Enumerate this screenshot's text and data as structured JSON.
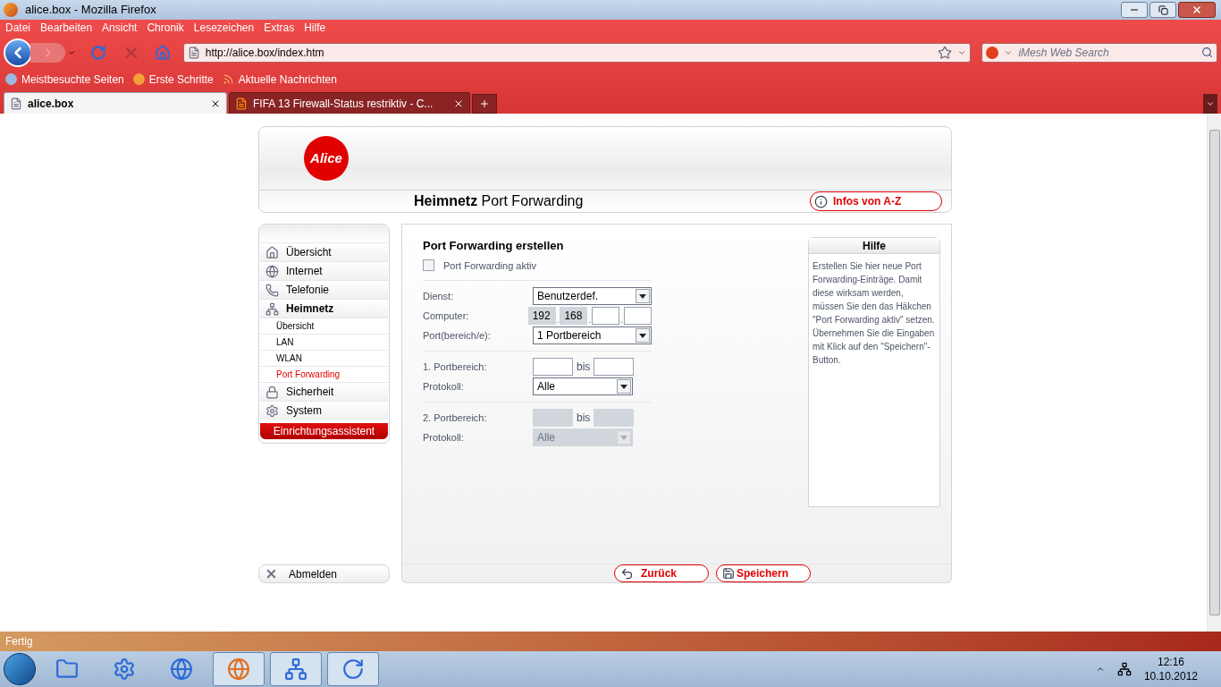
{
  "window": {
    "title": "alice.box - Mozilla Firefox"
  },
  "menu": [
    "Datei",
    "Bearbeiten",
    "Ansicht",
    "Chronik",
    "Lesezeichen",
    "Extras",
    "Hilfe"
  ],
  "navigation": {
    "url": "http://alice.box/index.htm",
    "search_placeholder": "iMesh Web Search"
  },
  "bookmarks": [
    "Meistbesuchte Seiten",
    "Erste Schritte",
    "Aktuelle Nachrichten"
  ],
  "tabs": [
    {
      "label": "alice.box",
      "selected": true
    },
    {
      "label": "FIFA 13 Firewall-Status restriktiv - C...",
      "selected": false
    }
  ],
  "page": {
    "logo": "Alice",
    "heading": "**Heimnetz** Port Forwarding",
    "infos_button": "Infos von A-Z",
    "sidebar": [
      {
        "label": "Übersicht",
        "expanded": false
      },
      {
        "label": "Internet",
        "expanded": false
      },
      {
        "label": "Telefonie",
        "expanded": false
      },
      {
        "label": "Heimnetz",
        "expanded": true,
        "children": [
          {
            "label": "Übersicht",
            "selected": false
          },
          {
            "label": "LAN",
            "selected": false
          },
          {
            "label": "WLAN",
            "selected": false
          },
          {
            "label": "Port Forwarding",
            "selected": true
          }
        ]
      },
      {
        "label": "Sicherheit",
        "expanded": false
      },
      {
        "label": "System",
        "expanded": false
      }
    ],
    "wizard_button": "Einrichtungsassistent",
    "logout_button": "Abmelden",
    "form": {
      "title": "Port Forwarding erstellen",
      "active_checkbox": {
        "label": "Port Forwarding aktiv",
        "checked": false
      },
      "sections": [
        [
          {
            "kind": "select",
            "label": "Dienst:",
            "value": "Benutzerdef.",
            "disabled": false
          },
          {
            "kind": "ip",
            "label": "Computer:",
            "separator": ".",
            "octets": [
              {
                "value": "192",
                "disabled": true
              },
              {
                "value": "168",
                "disabled": true
              },
              {
                "disabled": false
              },
              {
                "disabled": false
              }
            ]
          },
          {
            "kind": "select",
            "label": "Port(bereich/e):",
            "value": "1 Portbereich",
            "disabled": false
          }
        ],
        [
          {
            "kind": "range",
            "label": "1. Portbereich:",
            "connector": "bis",
            "disabled": false
          },
          {
            "kind": "short_select",
            "label": "Protokoll:",
            "value": "Alle",
            "disabled": false
          }
        ],
        [
          {
            "kind": "range",
            "label": "2. Portbereich:",
            "connector": "bis",
            "disabled": true
          },
          {
            "kind": "short_select",
            "label": "Protokoll:",
            "value": "Alle",
            "disabled": true
          }
        ]
      ]
    },
    "help": {
      "title": "Hilfe",
      "text": "Erstellen Sie hier neue Port Forwarding-Einträge. Damit diese wirksam werden, müssen Sie den das Häkchen \"Port Forwarding aktiv\" setzen. Übernehmen Sie die Eingaben mit Klick auf den \"Speichern\"-Button."
    },
    "back_button": "Zurück",
    "save_button": "Speichern"
  },
  "status_bar": "Fertig",
  "clock": {
    "time": "12:16",
    "date": "10.10.2012"
  }
}
